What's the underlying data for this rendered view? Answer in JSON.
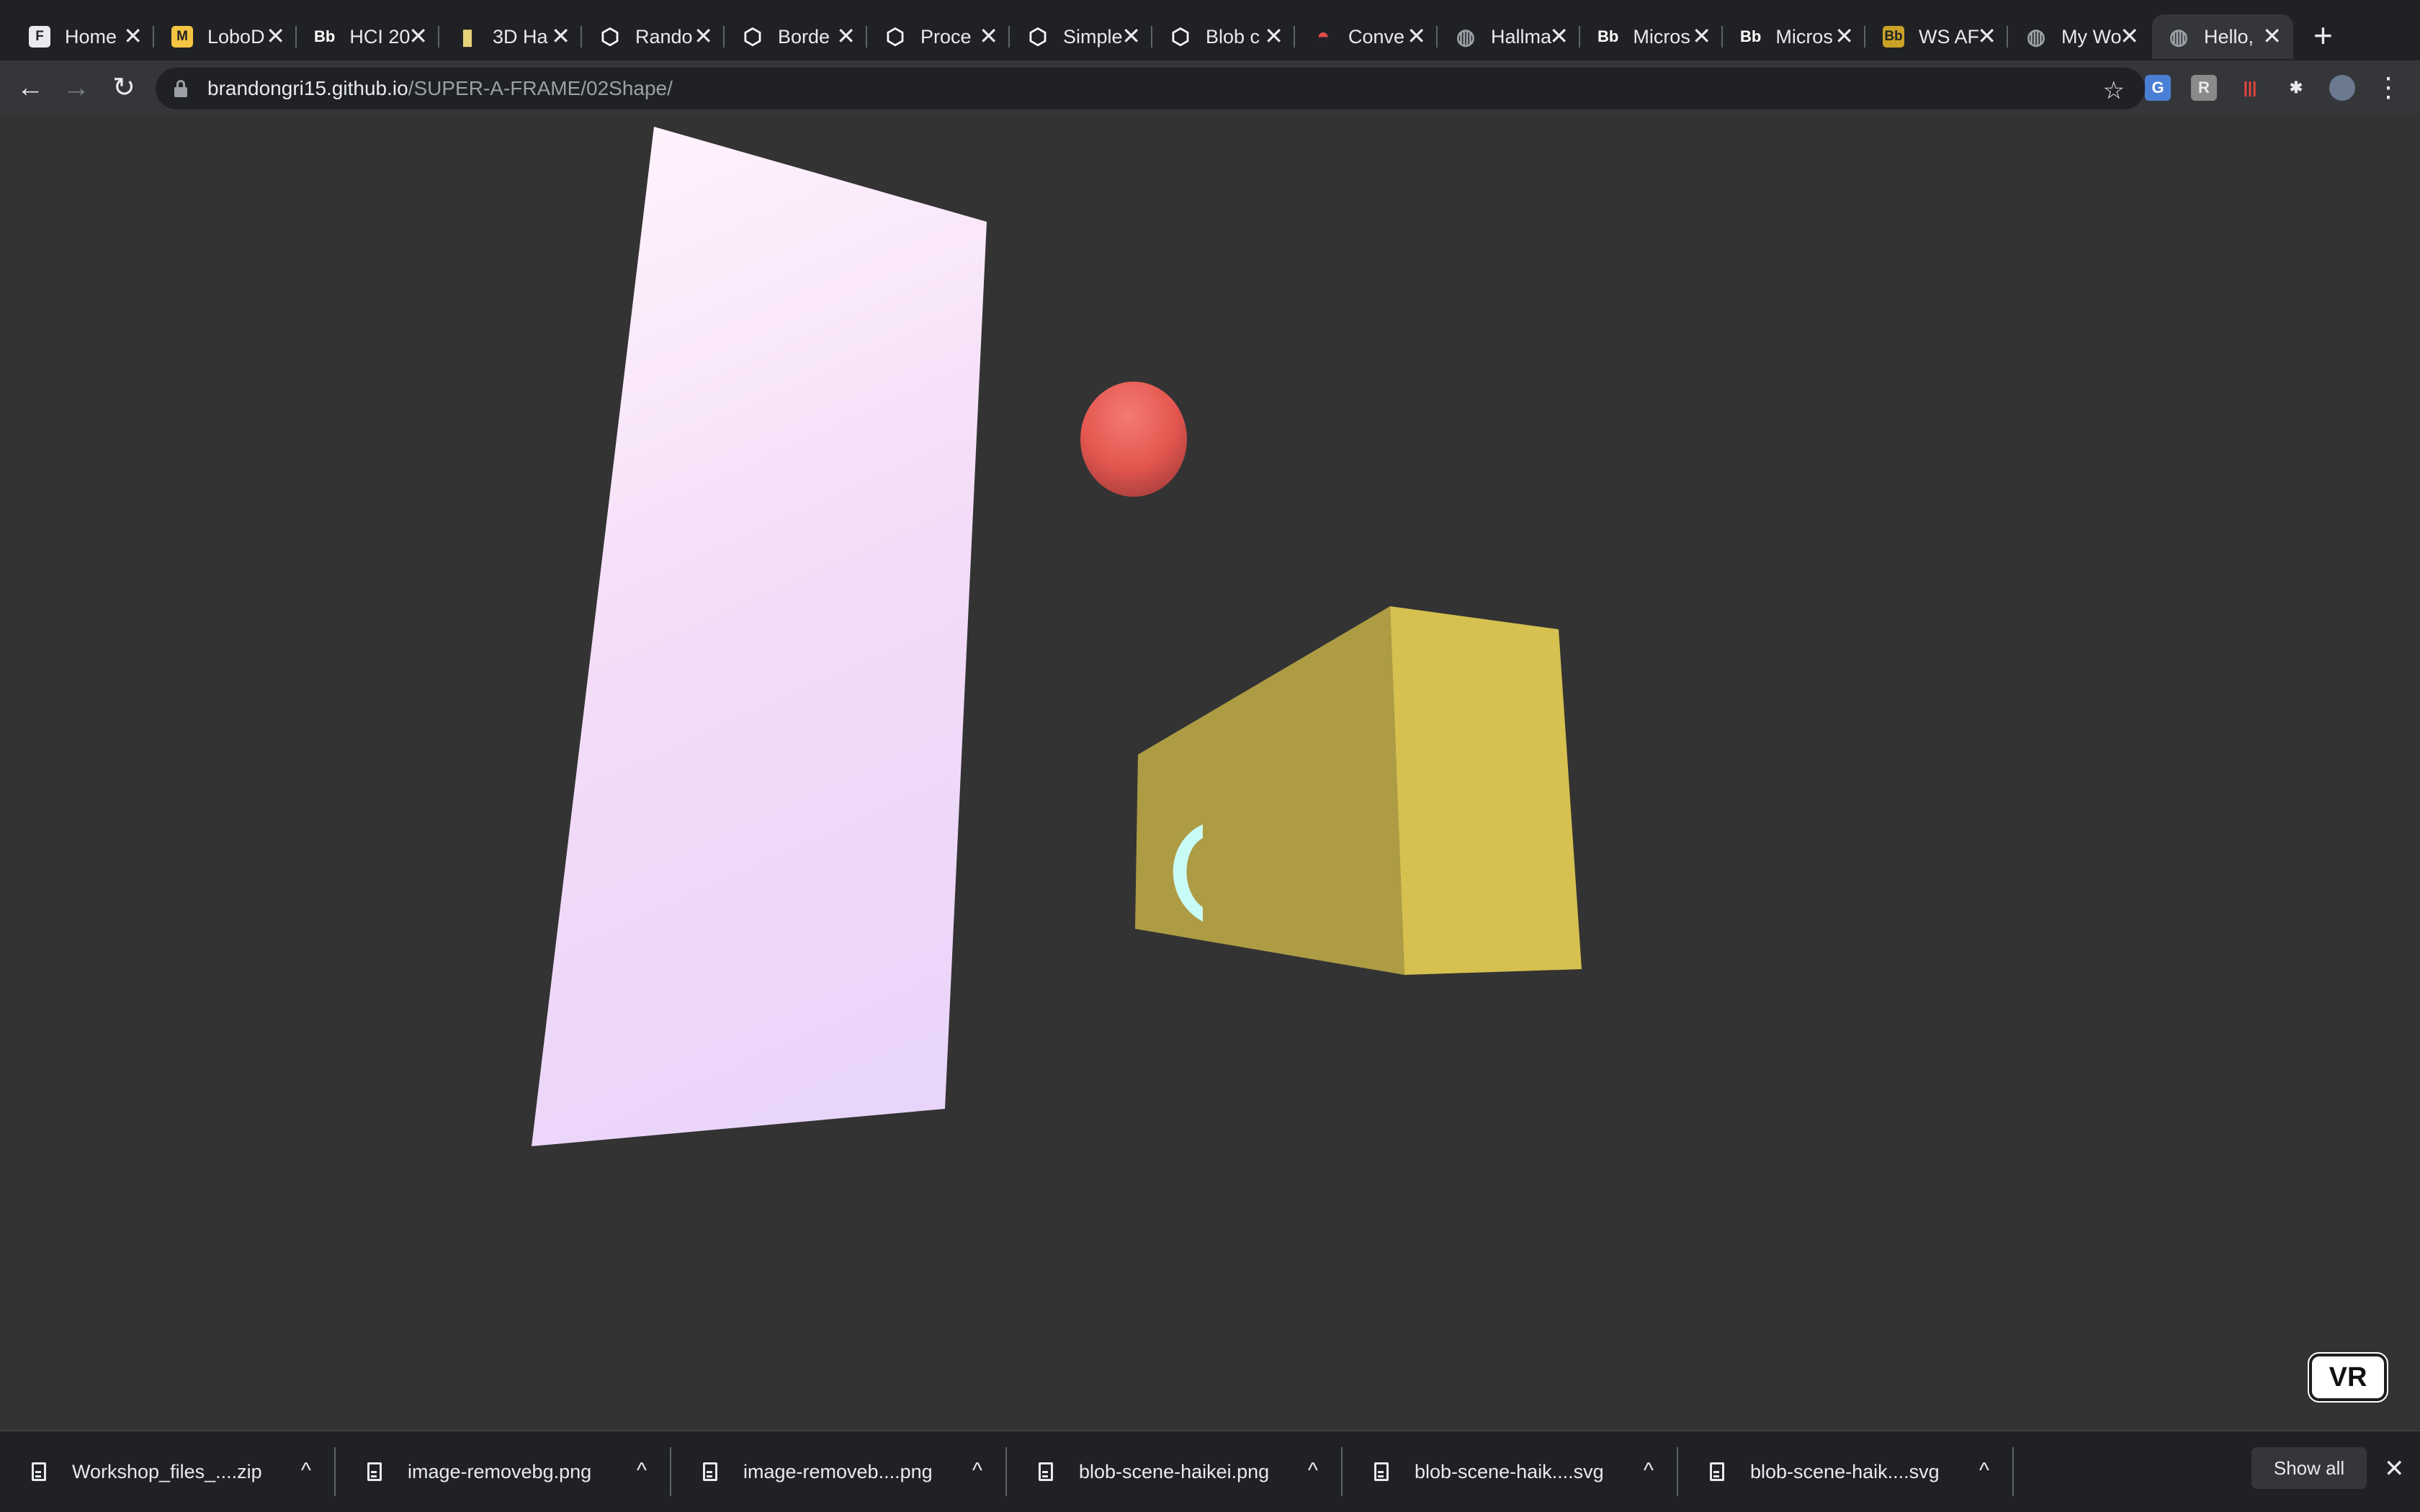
{
  "tabs": [
    {
      "title": "Home",
      "icon": "figma-icon",
      "favicon_text": "F",
      "color": "#3c4043"
    },
    {
      "title": "LoboD",
      "icon": "miro-icon",
      "favicon_text": "M",
      "color": "#f5c542"
    },
    {
      "title": "HCI 20",
      "icon": "blackboard-icon",
      "favicon_text": "Bb",
      "color": ""
    },
    {
      "title": "3D Ha",
      "icon": "bookmark-icon",
      "favicon_text": "▮",
      "color": "#e8d27a"
    },
    {
      "title": "Rando",
      "icon": "codepen-icon",
      "favicon_text": "⬡",
      "color": "#ffffff"
    },
    {
      "title": "Borde",
      "icon": "codepen-icon",
      "favicon_text": "⬡",
      "color": "#ffffff"
    },
    {
      "title": "Proce",
      "icon": "codepen-icon",
      "favicon_text": "⬡",
      "color": "#ffffff"
    },
    {
      "title": "Simple",
      "icon": "codepen-icon",
      "favicon_text": "⬡",
      "color": "#ffffff"
    },
    {
      "title": "Blob c",
      "icon": "codepen-icon",
      "favicon_text": "⬡",
      "color": "#ffffff"
    },
    {
      "title": "Conve",
      "icon": "converter-icon",
      "favicon_text": "◓",
      "color": "#e34c4c"
    },
    {
      "title": "Hallma",
      "icon": "globe-icon",
      "favicon_text": "◍",
      "color": "#9aa0a6"
    },
    {
      "title": "Micros",
      "icon": "blackboard-icon",
      "favicon_text": "Bb",
      "color": ""
    },
    {
      "title": "Micros",
      "icon": "blackboard-icon",
      "favicon_text": "Bb",
      "color": ""
    },
    {
      "title": "WS AF",
      "icon": "ws-icon",
      "favicon_text": "Bb",
      "color": "#c9a227"
    },
    {
      "title": "My Wo",
      "icon": "globe-icon",
      "favicon_text": "◍",
      "color": "#9aa0a6"
    },
    {
      "title": "Hello,",
      "icon": "globe-icon",
      "favicon_text": "◍",
      "color": "#9aa0a6",
      "active": true
    }
  ],
  "toolbar": {
    "back": "←",
    "forward": "→",
    "reload": "↻",
    "url_host": "brandongri15.github.io",
    "url_path": "/SUPER-A-FRAME/02Shape/",
    "star": "☆",
    "new_tab": "+",
    "tab_close": "✕",
    "extensions": [
      {
        "icon": "translate-icon",
        "text": "G",
        "bg": "#4a7fd6",
        "fg": "#ffffff"
      },
      {
        "icon": "extension-r-icon",
        "text": "R",
        "bg": "#8a8a8a",
        "fg": "#e8eaed"
      },
      {
        "icon": "kami-icon",
        "text": "|||",
        "bg": "#35363a",
        "fg": "#e8453c"
      },
      {
        "icon": "puzzle-icon",
        "text": "✱",
        "bg": "#35363a",
        "fg": "#e8eaed"
      },
      {
        "icon": "profile-avatar-icon",
        "text": "",
        "bg": "#6b7a8f",
        "fg": "#ffffff"
      }
    ],
    "menu": "⋮"
  },
  "scene": {
    "background": "#333333",
    "vr_label": "VR",
    "plane_color": "#f3dcf7",
    "sphere_color": "#ef5350",
    "box_color": "#d6c04f",
    "cylinder_color": "#c9fbf6"
  },
  "downloads": [
    {
      "name": "Workshop_files_....zip"
    },
    {
      "name": "image-removebg.png"
    },
    {
      "name": "image-removeb....png"
    },
    {
      "name": "blob-scene-haikei.png"
    },
    {
      "name": "blob-scene-haik....svg"
    },
    {
      "name": "blob-scene-haik....svg"
    }
  ],
  "shelf": {
    "show_all": "Show all",
    "close": "✕",
    "chevron": "^"
  }
}
